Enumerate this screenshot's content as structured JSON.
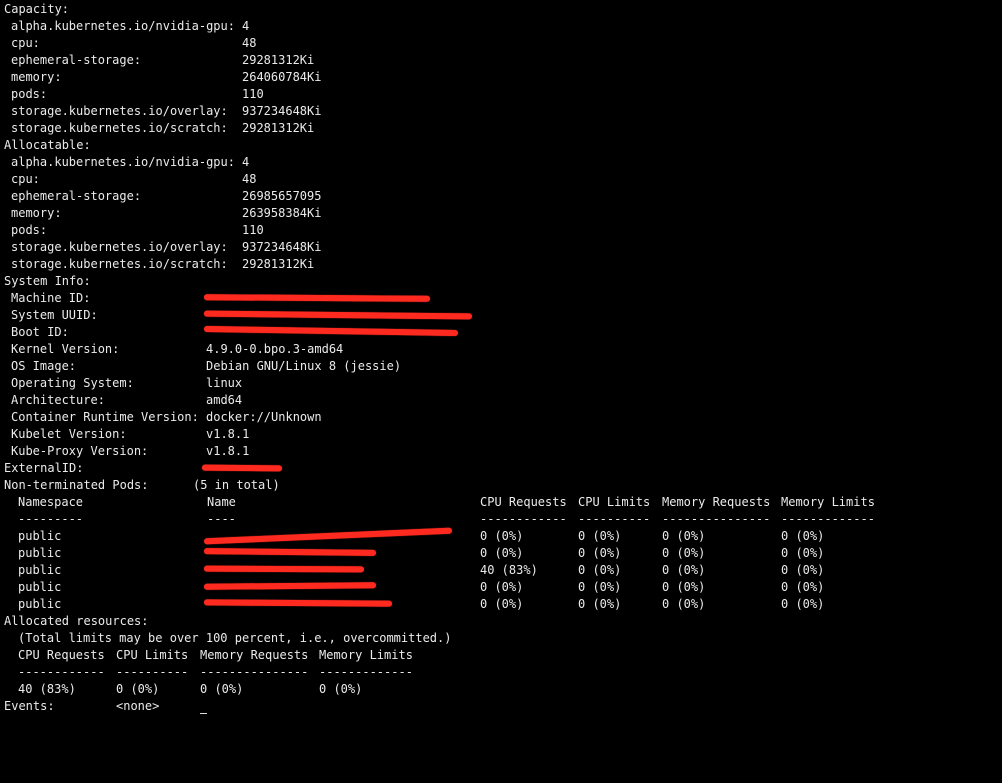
{
  "capacity": {
    "title": "Capacity:",
    "rows": [
      {
        "key": "alpha.kubernetes.io/nvidia-gpu:",
        "value": "4"
      },
      {
        "key": "cpu:",
        "value": "48"
      },
      {
        "key": "ephemeral-storage:",
        "value": "29281312Ki"
      },
      {
        "key": "memory:",
        "value": "264060784Ki"
      },
      {
        "key": "pods:",
        "value": "110"
      },
      {
        "key": "storage.kubernetes.io/overlay:",
        "value": "937234648Ki"
      },
      {
        "key": "storage.kubernetes.io/scratch:",
        "value": "29281312Ki"
      }
    ]
  },
  "allocatable": {
    "title": "Allocatable:",
    "rows": [
      {
        "key": "alpha.kubernetes.io/nvidia-gpu:",
        "value": "4"
      },
      {
        "key": "cpu:",
        "value": "48"
      },
      {
        "key": "ephemeral-storage:",
        "value": "26985657095"
      },
      {
        "key": "memory:",
        "value": "263958384Ki"
      },
      {
        "key": "pods:",
        "value": "110"
      },
      {
        "key": "storage.kubernetes.io/overlay:",
        "value": "937234648Ki"
      },
      {
        "key": "storage.kubernetes.io/scratch:",
        "value": "29281312Ki"
      }
    ]
  },
  "system_info": {
    "title": "System Info:",
    "rows": [
      {
        "key": "Machine ID:",
        "value": ""
      },
      {
        "key": "System UUID:",
        "value": ""
      },
      {
        "key": "Boot ID:",
        "value": ""
      },
      {
        "key": "Kernel Version:",
        "value": "4.9.0-0.bpo.3-amd64"
      },
      {
        "key": "OS Image:",
        "value": "Debian GNU/Linux 8 (jessie)"
      },
      {
        "key": "Operating System:",
        "value": "linux"
      },
      {
        "key": "Architecture:",
        "value": "amd64"
      },
      {
        "key": "Container Runtime Version:",
        "value": "docker://Unknown"
      },
      {
        "key": "Kubelet Version:",
        "value": "v1.8.1"
      },
      {
        "key": "Kube-Proxy Version:",
        "value": "v1.8.1"
      }
    ]
  },
  "external_id": {
    "key": "ExternalID:",
    "value": ""
  },
  "pods": {
    "title": "Non-terminated Pods:",
    "summary": "(5 in total)",
    "headers": [
      "Namespace",
      "Name",
      "CPU Requests",
      "CPU Limits",
      "Memory Requests",
      "Memory Limits"
    ],
    "underlines": [
      "---------",
      "----",
      "------------",
      "----------",
      "---------------",
      "-------------"
    ],
    "rows": [
      {
        "namespace": "public",
        "name": "",
        "cpu_requests": "0 (0%)",
        "cpu_limits": "0 (0%)",
        "memory_requests": "0 (0%)",
        "memory_limits": "0 (0%)"
      },
      {
        "namespace": "public",
        "name": "",
        "cpu_requests": "0 (0%)",
        "cpu_limits": "0 (0%)",
        "memory_requests": "0 (0%)",
        "memory_limits": "0 (0%)"
      },
      {
        "namespace": "public",
        "name": "",
        "cpu_requests": "40 (83%)",
        "cpu_limits": "0 (0%)",
        "memory_requests": "0 (0%)",
        "memory_limits": "0 (0%)"
      },
      {
        "namespace": "public",
        "name": "",
        "cpu_requests": "0 (0%)",
        "cpu_limits": "0 (0%)",
        "memory_requests": "0 (0%)",
        "memory_limits": "0 (0%)"
      },
      {
        "namespace": "public",
        "name": "",
        "cpu_requests": "0 (0%)",
        "cpu_limits": "0 (0%)",
        "memory_requests": "0 (0%)",
        "memory_limits": "0 (0%)"
      }
    ]
  },
  "allocated": {
    "title": "Allocated resources:",
    "note": "(Total limits may be over 100 percent, i.e., overcommitted.)",
    "headers": [
      "CPU Requests",
      "CPU Limits",
      "Memory Requests",
      "Memory Limits"
    ],
    "underlines": [
      "------------",
      "----------",
      "---------------",
      "-------------"
    ],
    "values": [
      "40 (83%)",
      "0 (0%)",
      "0 (0%)",
      "0 (0%)"
    ]
  },
  "events": {
    "key": "Events:",
    "value": "<none>"
  },
  "colors": {
    "background": "#000000",
    "text": "#ebebeb",
    "redaction": "#ff2a1f"
  }
}
